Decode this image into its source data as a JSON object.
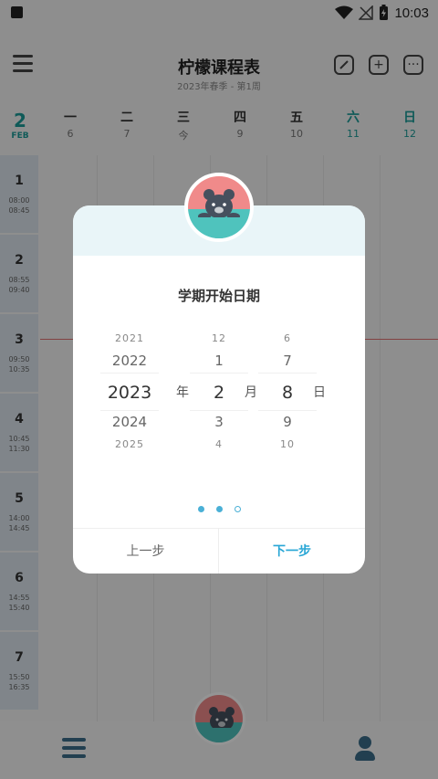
{
  "status_bar": {
    "time": "10:03"
  },
  "header": {
    "title": "柠檬课程表",
    "subtitle": "2023年春季 - 第1周",
    "icons": [
      "menu-icon",
      "edit-icon",
      "add-icon",
      "more-icon"
    ]
  },
  "week": {
    "month_num": "2",
    "month_label": "FEB",
    "days": [
      {
        "name": "一",
        "num": "6"
      },
      {
        "name": "二",
        "num": "7"
      },
      {
        "name": "三",
        "num": "今"
      },
      {
        "name": "四",
        "num": "9"
      },
      {
        "name": "五",
        "num": "10"
      },
      {
        "name": "六",
        "num": "11"
      },
      {
        "name": "日",
        "num": "12"
      }
    ]
  },
  "periods": [
    {
      "num": "1",
      "start": "08:00",
      "end": "08:45"
    },
    {
      "num": "2",
      "start": "08:55",
      "end": "09:40"
    },
    {
      "num": "3",
      "start": "09:50",
      "end": "10:35"
    },
    {
      "num": "4",
      "start": "10:45",
      "end": "11:30"
    },
    {
      "num": "5",
      "start": "14:00",
      "end": "14:45"
    },
    {
      "num": "6",
      "start": "14:55",
      "end": "15:40"
    },
    {
      "num": "7",
      "start": "15:50",
      "end": "16:35"
    }
  ],
  "dialog": {
    "title": "学期开始日期",
    "year": {
      "items": [
        "2021",
        "2022",
        "2023",
        "2024",
        "2025"
      ],
      "unit": "年"
    },
    "month": {
      "items": [
        "12",
        "1",
        "2",
        "3",
        "4"
      ],
      "unit": "月"
    },
    "day": {
      "items": [
        "6",
        "7",
        "8",
        "9",
        "10"
      ],
      "unit": "日"
    },
    "steps": {
      "total": 3,
      "current": 2
    },
    "prev_label": "上一步",
    "next_label": "下一步"
  },
  "colors": {
    "accent": "#1a9c98",
    "primary_blue": "#2aa7d6",
    "nav": "#3b6d8a"
  }
}
